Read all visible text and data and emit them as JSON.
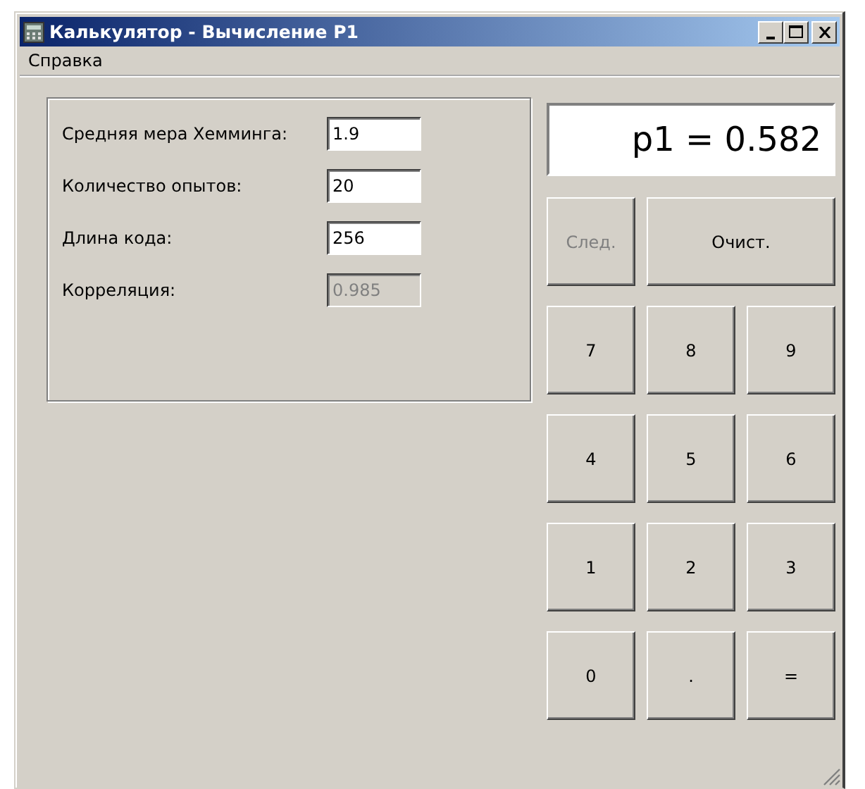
{
  "window": {
    "title": "Калькулятор - Вычисление P1"
  },
  "menu": [
    "Справка"
  ],
  "fields": [
    {
      "label": "Средняя мера Хемминга:",
      "value": "1.9",
      "disabled": false
    },
    {
      "label": "Количество опытов:",
      "value": "20",
      "disabled": false
    },
    {
      "label": "Длина кода:",
      "value": "256",
      "disabled": false
    },
    {
      "label": "Корреляция:",
      "value": "0.985",
      "disabled": true
    }
  ],
  "display": "p1 = 0.582",
  "actions": [
    {
      "label": "След.",
      "disabled": true
    },
    {
      "label": "Очист.",
      "disabled": false
    }
  ],
  "keys": [
    "7",
    "8",
    "9",
    "4",
    "5",
    "6",
    "1",
    "2",
    "3",
    "0",
    ".",
    "="
  ]
}
